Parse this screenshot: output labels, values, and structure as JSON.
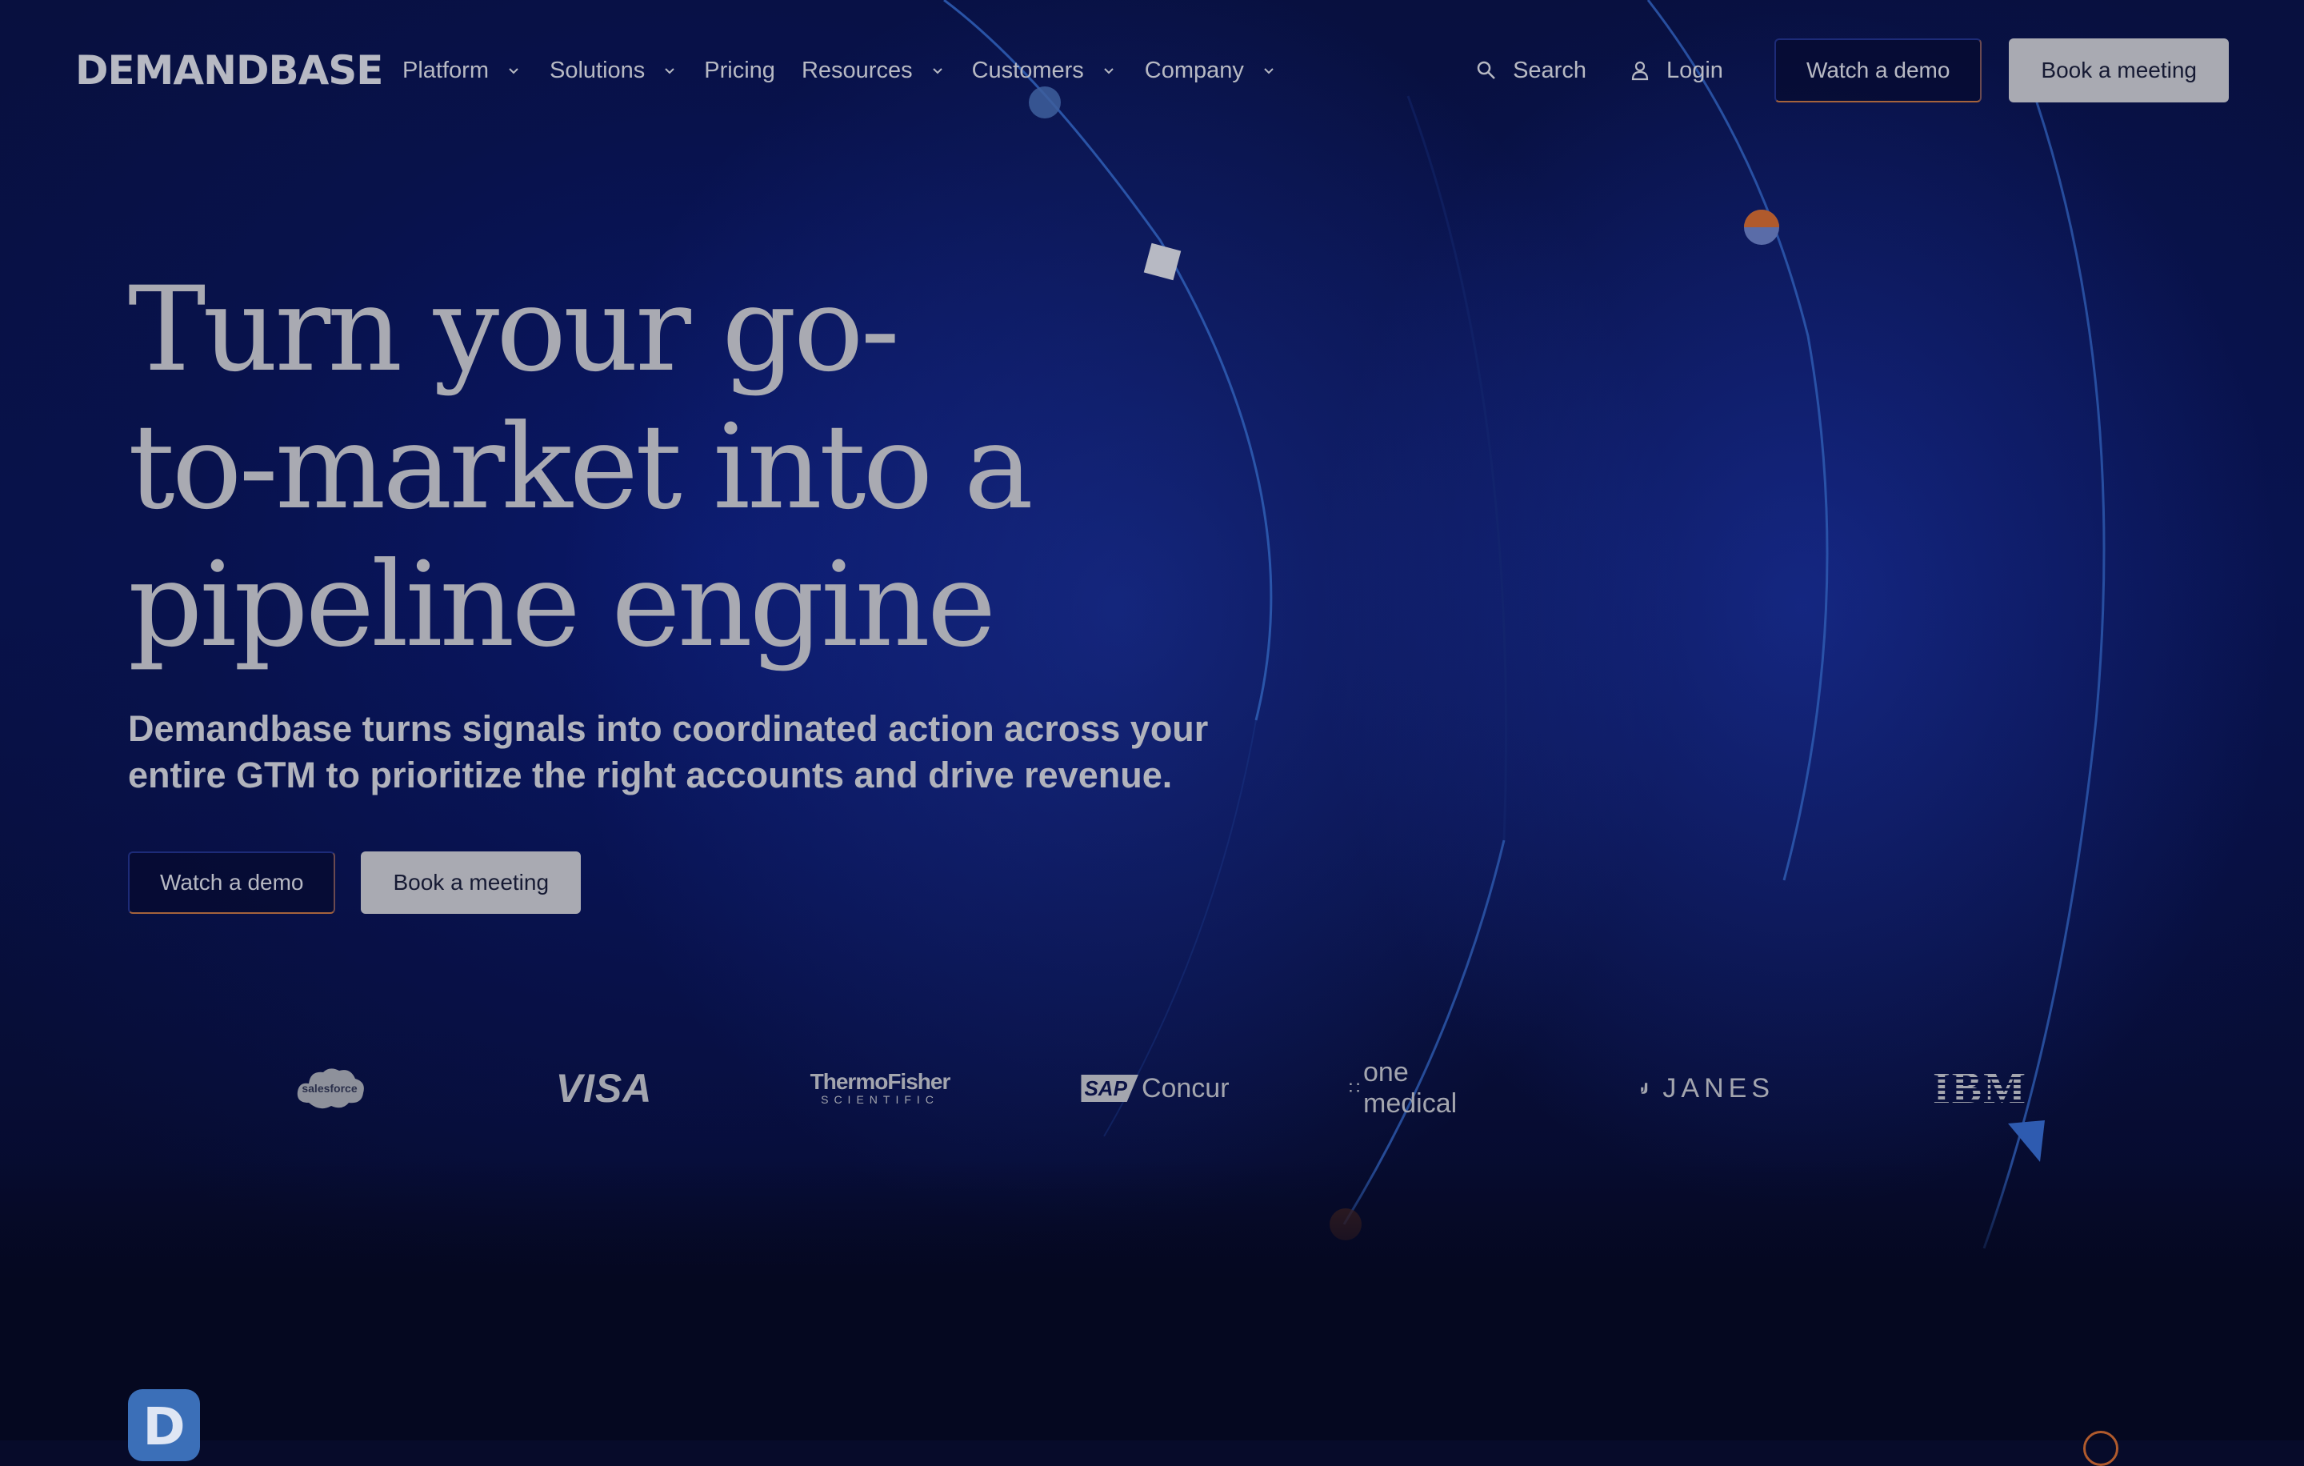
{
  "brand": {
    "logo_text": "DEMANDBASE"
  },
  "nav": {
    "items": [
      {
        "label": "Platform",
        "has_dropdown": true
      },
      {
        "label": "Solutions",
        "has_dropdown": true
      },
      {
        "label": "Pricing",
        "has_dropdown": false
      },
      {
        "label": "Resources",
        "has_dropdown": true
      },
      {
        "label": "Customers",
        "has_dropdown": true
      },
      {
        "label": "Company",
        "has_dropdown": true
      }
    ],
    "search_label": "Search",
    "login_label": "Login",
    "watch_demo_label": "Watch a demo",
    "book_meeting_label": "Book a meeting"
  },
  "hero": {
    "title_line1": "Turn your go-",
    "title_line2": "to-market into a",
    "title_line3": "pipeline engine",
    "subtitle": "Demandbase turns signals into coordinated action across your entire GTM to prioritize the right accounts and drive revenue.",
    "watch_demo_label": "Watch a demo",
    "book_meeting_label": "Book a meeting"
  },
  "customer_logos": {
    "salesforce": "salesforce",
    "visa": "VISA",
    "thermofisher_top": "ThermoFisher",
    "thermofisher_bottom": "SCIENTIFIC",
    "sap": "SAP",
    "concur": "Concur",
    "one_medical": "one medical",
    "janes": "JANES",
    "ibm": "IBM"
  },
  "colors": {
    "background": "#070b2a",
    "accent_orange": "#b05a2c",
    "accent_blue": "#3b6fb8",
    "button_light": "#a9aab2"
  }
}
